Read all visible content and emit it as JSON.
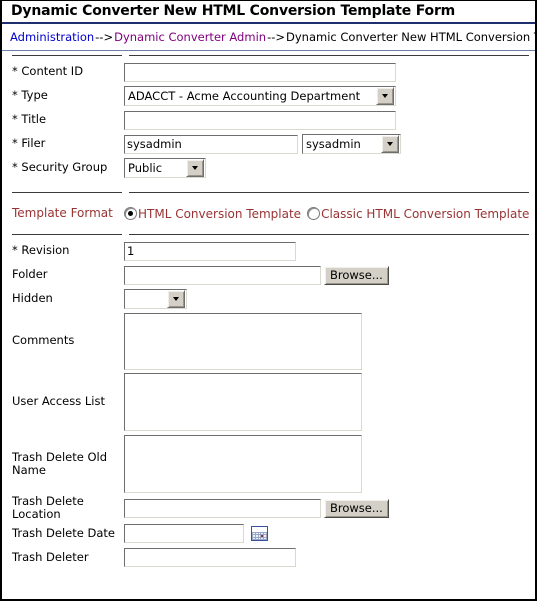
{
  "window": {
    "title": "Dynamic Converter New HTML Conversion Template Form"
  },
  "breadcrumb": {
    "items": [
      {
        "label": "Administration",
        "type": "link"
      },
      {
        "label": "Dynamic Converter Admin",
        "type": "link-visited"
      },
      {
        "label": "Dynamic Converter New HTML Conversion Template Form",
        "type": "current"
      }
    ],
    "separator": "-->"
  },
  "colors": {
    "link": "#0000cc",
    "link_visited": "#800080",
    "title_underline": "#1f2f6e",
    "highlight_text": "#993333",
    "control_face": "#d4d0c8"
  },
  "form": {
    "required_marker": "*",
    "fields": {
      "content_id": {
        "label": "* Content ID",
        "value": "",
        "placeholder": ""
      },
      "type": {
        "label": "* Type",
        "value": "ADACCT - Acme Accounting Department"
      },
      "title": {
        "label": "* Title",
        "value": "",
        "placeholder": ""
      },
      "filer": {
        "label": "* Filer",
        "value": "sysadmin",
        "select_value": "sysadmin"
      },
      "security_group": {
        "label": "* Security Group",
        "value": "Public"
      },
      "template_format": {
        "label": "Template Format",
        "options": [
          {
            "label": "HTML Conversion Template",
            "checked": true
          },
          {
            "label": "Classic HTML Conversion Template",
            "checked": false
          }
        ]
      },
      "revision": {
        "label": "* Revision",
        "value": "1"
      },
      "folder": {
        "label": "Folder",
        "value": "",
        "browse_label": "Browse..."
      },
      "hidden": {
        "label": "Hidden",
        "value": ""
      },
      "comments": {
        "label": "Comments",
        "value": ""
      },
      "user_access_list": {
        "label": "User Access List",
        "value": ""
      },
      "trash_delete_old_name": {
        "label": "Trash Delete Old Name",
        "value": ""
      },
      "trash_delete_location": {
        "label": "Trash Delete Location",
        "value": "",
        "browse_label": "Browse..."
      },
      "trash_delete_date": {
        "label": "Trash Delete Date",
        "value": ""
      },
      "trash_deleter": {
        "label": "Trash Deleter",
        "value": ""
      }
    }
  },
  "icons": {
    "calendar": "calendar-icon",
    "dropdown_arrow": "chevron-down-icon"
  }
}
